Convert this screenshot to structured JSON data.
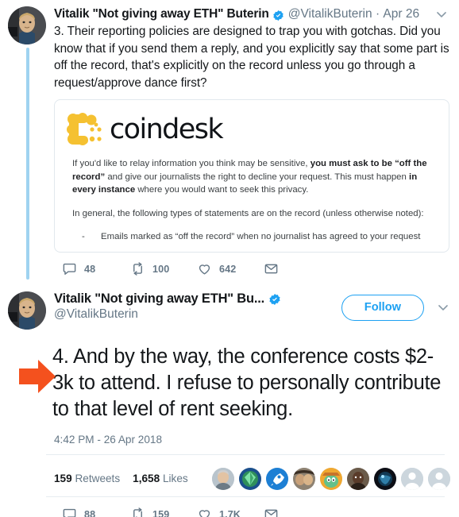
{
  "theme": {
    "brand_blue": "#1da1f2",
    "thread_line": "#9fd3f0",
    "muted": "#657786",
    "text": "#14171a",
    "border": "#e6ecf0",
    "annotation_orange": "#f4511e",
    "coindesk_yellow": "#f5c131"
  },
  "tweet1": {
    "display_name": "Vitalik \"Not giving away ETH\" Buterin",
    "verified_icon": "verified-badge-icon",
    "handle": "@VitalikButerin",
    "separator": "·",
    "date": "Apr 26",
    "caret_icon": "chevron-down-icon",
    "text": "3. Their reporting policies are designed to trap you with gotchas. Did you know that if you send them a reply, and you explicitly say that some part is off the record, that's explicitly on the record unless you go through a request/approve dance first?",
    "actions": {
      "reply_icon": "reply-icon",
      "reply_count": "48",
      "retweet_icon": "retweet-icon",
      "retweet_count": "100",
      "like_icon": "heart-icon",
      "like_count": "642",
      "dm_icon": "envelope-icon"
    }
  },
  "card": {
    "logo_mark": "coindesk-dots-logo-icon",
    "wordmark": "coindesk",
    "paragraph1_part1": "If you'd like to relay information you think may be sensitive, ",
    "paragraph1_bold1": "you must ask to be “off the record”",
    "paragraph1_part2": " and give our journalists the right to decline your request. This must happen ",
    "paragraph1_bold2": "in every instance",
    "paragraph1_part3": " where you would want to seek this privacy.",
    "paragraph2": "In general, the following types of statements are on the record (unless otherwise noted):",
    "bullet_dash": "-",
    "bullet_text": "Emails marked as “off the record” when no journalist has agreed to your request"
  },
  "tweet2": {
    "display_name": "Vitalik \"Not giving away ETH\" Bu...",
    "verified_icon": "verified-badge-icon",
    "handle": "@VitalikButerin",
    "follow_label": "Follow",
    "caret_icon": "chevron-down-icon",
    "annotation_icon": "orange-arrow-annotation-icon",
    "text": "4. And by the way, the conference costs $2-3k to attend. I refuse to personally contribute to that level of rent seeking.",
    "timestamp": "4:42 PM - 26 Apr 2018",
    "stats": {
      "retweet_count": "159",
      "retweet_label": "Retweets",
      "like_count": "1,658",
      "like_label": "Likes"
    },
    "likers": [
      {
        "name": "liker-avatar-1",
        "colors": [
          "#c8b49a",
          "#7e6a55"
        ]
      },
      {
        "name": "liker-avatar-2",
        "colors": [
          "#2f7f4f",
          "#1c4f8a"
        ]
      },
      {
        "name": "liker-avatar-3",
        "colors": [
          "#1d7fd4",
          "#0d5fa8"
        ]
      },
      {
        "name": "liker-avatar-4",
        "colors": [
          "#6b5a45",
          "#3a2f24"
        ]
      },
      {
        "name": "liker-avatar-5",
        "colors": [
          "#f0a830",
          "#3aa05a"
        ]
      },
      {
        "name": "liker-avatar-6",
        "colors": [
          "#4a3226",
          "#241711"
        ]
      },
      {
        "name": "liker-avatar-7",
        "colors": [
          "#1a1a2e",
          "#0a3b5c"
        ]
      },
      {
        "name": "liker-avatar-8-default",
        "colors": [
          "#ccd6dd",
          "#ffffff"
        ]
      },
      {
        "name": "liker-avatar-9-default",
        "colors": [
          "#ccd6dd",
          "#ffffff"
        ]
      }
    ],
    "actions": {
      "reply_icon": "reply-icon",
      "reply_count": "88",
      "retweet_icon": "retweet-icon",
      "retweet_count": "159",
      "like_icon": "heart-icon",
      "like_count": "1.7K",
      "dm_icon": "envelope-icon"
    }
  }
}
